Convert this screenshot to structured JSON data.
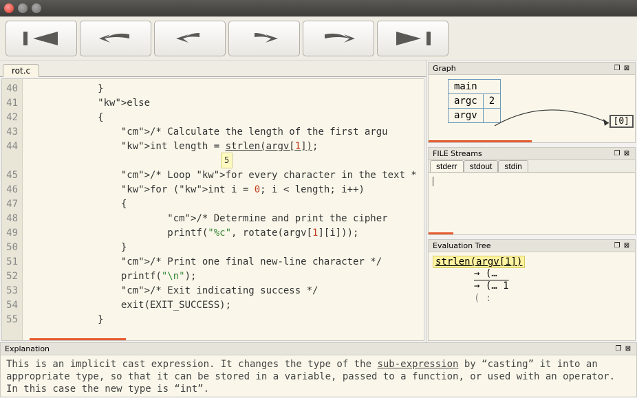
{
  "titlebar": {
    "title": ""
  },
  "toolbar": {
    "buttons": [
      "step-to-start",
      "step-back-over",
      "step-back-into",
      "step-into",
      "step-over",
      "step-to-end"
    ]
  },
  "editor": {
    "tab_label": "rot.c",
    "first_line": 40,
    "inline_value": "5",
    "lines_plain": [
      "            }",
      "            else",
      "            {",
      "                /* Calculate the length of the first argu",
      "                int length = strlen(argv[1]);",
      "",
      "                /* Loop for every character in the text *",
      "                for (int i = 0; i < length; i++)",
      "                {",
      "                        /* Determine and print the cipher",
      "                        printf(\"%c\", rotate(argv[1][i]));",
      "                }",
      "                /* Print one final new-line character */",
      "                printf(\"\\n\");",
      "                /* Exit indicating success */",
      "                exit(EXIT_SUCCESS);",
      "            }"
    ],
    "line_numbers": [
      "40",
      "41",
      "42",
      "43",
      "44",
      "",
      "45",
      "46",
      "47",
      "48",
      "49",
      "50",
      "51",
      "52",
      "53",
      "54",
      "55"
    ]
  },
  "graph": {
    "title": "Graph",
    "rows": [
      [
        "main"
      ],
      [
        "argc",
        "2"
      ],
      [
        "argv"
      ]
    ],
    "extra_label": "[0]"
  },
  "file_streams": {
    "title": "FILE Streams",
    "tabs": [
      "stderr",
      "stdout",
      "stdin"
    ],
    "active_tab": 0,
    "content": ""
  },
  "eval_tree": {
    "title": "Evaluation Tree",
    "expr": "strlen(argv[1])",
    "lines": [
      "→ (…",
      "→ (… 1",
      "  (  :"
    ]
  },
  "explanation": {
    "title": "Explanation",
    "pre": "This is an implicit cast expression. It changes the type of the ",
    "link": "sub-expression",
    "post1": " by “casting” it into an appropriate type, so that it can be stored in a variable, passed to a function, or used with an operator. In this case the new type is “int”."
  }
}
